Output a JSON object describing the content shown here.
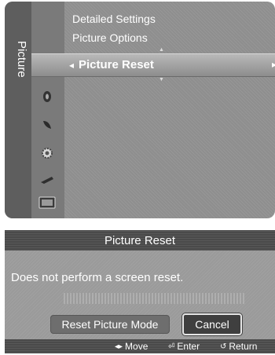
{
  "menu": {
    "category": "Picture",
    "items": [
      {
        "label": "Detailed Settings"
      },
      {
        "label": "Picture Options"
      },
      {
        "label": "Picture Reset",
        "selected": true
      }
    ],
    "side_icons": [
      "picture-icon",
      "sound-icon",
      "channel-icon",
      "setup-icon",
      "input-icon",
      "application-icon"
    ]
  },
  "dialog": {
    "title": "Picture Reset",
    "message": "Does not perform a screen reset.",
    "buttons": [
      {
        "label": "Reset Picture Mode"
      },
      {
        "label": "Cancel",
        "focused": true
      }
    ],
    "footer": {
      "move": "Move",
      "enter": "Enter",
      "return": "Return"
    }
  }
}
